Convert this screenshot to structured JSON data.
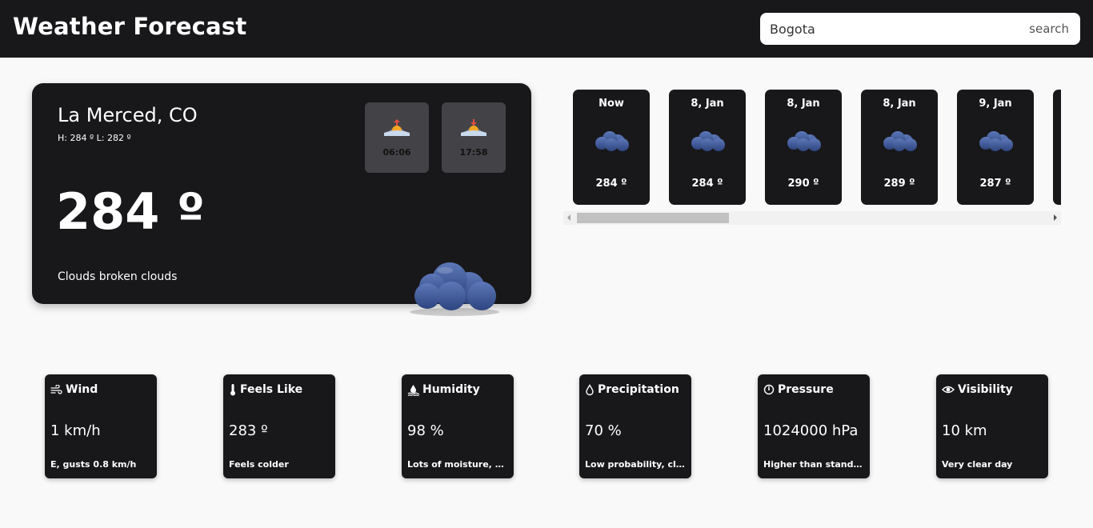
{
  "header": {
    "title": "Weather Forecast",
    "search_value": "Bogota",
    "search_label": "search"
  },
  "current": {
    "location": "La Merced, CO",
    "hilo": "H: 284 º L: 282 º",
    "temperature": "284 º",
    "description": "Clouds broken clouds",
    "sunrise": "06:06",
    "sunset": "17:58",
    "icon": "broken-clouds-icon"
  },
  "forecast": [
    {
      "label": "Now",
      "temp": "284 º",
      "icon": "broken-clouds-icon"
    },
    {
      "label": "8, Jan",
      "temp": "284 º",
      "icon": "broken-clouds-icon"
    },
    {
      "label": "8, Jan",
      "temp": "290 º",
      "icon": "broken-clouds-icon"
    },
    {
      "label": "8, Jan",
      "temp": "289 º",
      "icon": "broken-clouds-icon"
    },
    {
      "label": "9, Jan",
      "temp": "287 º",
      "icon": "broken-clouds-icon"
    }
  ],
  "metrics": [
    {
      "title": "Wind",
      "value": "1 km/h",
      "note": "E, gusts 0.8 km/h",
      "icon": "wind-icon"
    },
    {
      "title": "Feels Like",
      "value": "283 º",
      "note": "Feels colder",
      "icon": "thermometer-icon"
    },
    {
      "title": "Humidity",
      "value": "98 %",
      "note": "Lots of moisture, uncomfortable",
      "icon": "humidity-icon"
    },
    {
      "title": "Precipitation",
      "value": "70 %",
      "note": "Low probability, clear sky",
      "icon": "droplet-icon"
    },
    {
      "title": "Pressure",
      "value": "1024000 hPa",
      "note": "Higher than standard pressure",
      "icon": "gauge-icon"
    },
    {
      "title": "Visibility",
      "value": "10 km",
      "note": "Very clear day",
      "icon": "eye-icon"
    }
  ],
  "colors": {
    "background": "#f9f9f9",
    "card": "#18181b",
    "tile": "#434347",
    "cloud": "#3d5a99"
  }
}
